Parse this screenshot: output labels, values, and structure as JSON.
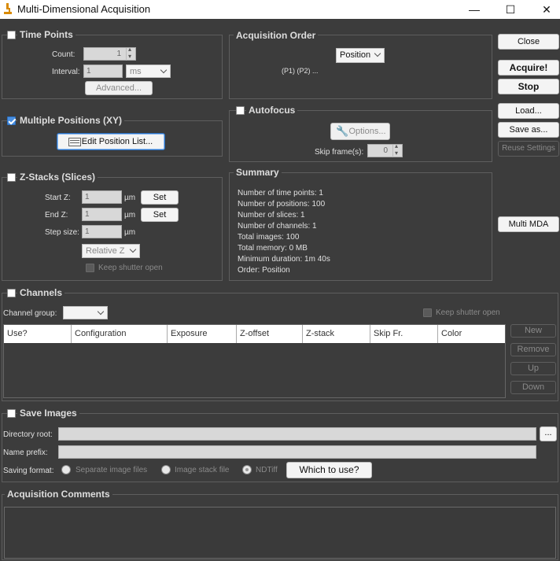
{
  "window": {
    "title": "Multi-Dimensional Acquisition",
    "minimize": "—",
    "maximize": "☐",
    "close": "✕"
  },
  "time_points": {
    "title": "Time Points",
    "checked": false,
    "count_label": "Count:",
    "count_value": "1",
    "interval_label": "Interval:",
    "interval_value": "1",
    "interval_unit": "ms",
    "advanced": "Advanced..."
  },
  "acq_order": {
    "title": "Acquisition Order",
    "selected": "Position",
    "sequence": "(P1) (P2) ..."
  },
  "positions": {
    "title": "Multiple Positions (XY)",
    "checked": true,
    "edit": "Edit Position List..."
  },
  "autofocus": {
    "title": "Autofocus",
    "checked": false,
    "options": "Options...",
    "skip_label": "Skip frame(s):",
    "skip_value": "0"
  },
  "zstack": {
    "title": "Z-Stacks (Slices)",
    "checked": false,
    "start_label": "Start Z:",
    "start_value": "1",
    "end_label": "End Z:",
    "end_value": "1",
    "step_label": "Step size:",
    "step_value": "1",
    "unit": "µm",
    "set": "Set",
    "mode": "Relative Z",
    "keep_shutter": "Keep shutter open"
  },
  "summary": {
    "title": "Summary",
    "lines": [
      "Number of time points: 1",
      "Number of positions: 100",
      "Number of slices: 1",
      "Number of channels: 1",
      "Total images: 100",
      "Total memory: 0 MB",
      "Minimum duration: 1m 40s",
      "Order: Position"
    ]
  },
  "side_buttons": {
    "close": "Close",
    "acquire": "Acquire!",
    "stop": "Stop",
    "load": "Load...",
    "save_as": "Save as...",
    "reuse": "Reuse Settings",
    "multi_mda": "Multi MDA"
  },
  "channels": {
    "title": "Channels",
    "checked": false,
    "group_label": "Channel group:",
    "keep_shutter": "Keep shutter open",
    "columns": [
      "Use?",
      "Configuration",
      "Exposure",
      "Z-offset",
      "Z-stack",
      "Skip Fr.",
      "Color"
    ],
    "new": "New",
    "remove": "Remove",
    "up": "Up",
    "down": "Down"
  },
  "save_images": {
    "title": "Save Images",
    "checked": false,
    "dir_label": "Directory root:",
    "dir_value": "",
    "browse": "...",
    "prefix_label": "Name prefix:",
    "prefix_value": "",
    "format_label": "Saving format:",
    "opt_separate": "Separate image files",
    "opt_stack": "Image stack file",
    "opt_ndtiff": "NDTiff",
    "which": "Which to use?"
  },
  "comments": {
    "title": "Acquisition Comments"
  }
}
